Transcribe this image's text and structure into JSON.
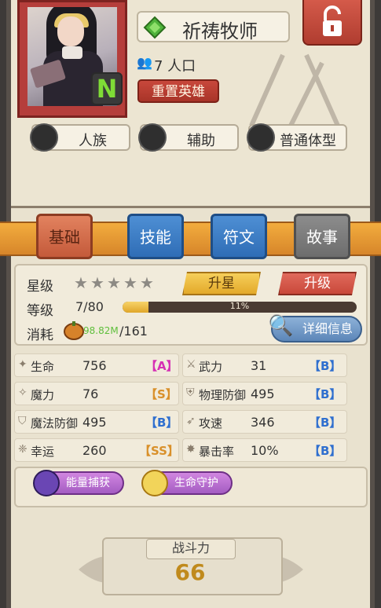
{
  "hero": {
    "name": "祈祷牧师",
    "rarity": "N",
    "population": "7 人口",
    "reset_label": "重置英雄"
  },
  "tags": [
    {
      "label": "人族",
      "icon": "human-head-icon"
    },
    {
      "label": "辅助",
      "icon": "support-cross-icon"
    },
    {
      "label": "普通体型",
      "icon": "body-silhouette-icon"
    }
  ],
  "tabs": [
    {
      "label": "基础",
      "active": true
    },
    {
      "label": "技能"
    },
    {
      "label": "符文"
    },
    {
      "label": "故事"
    }
  ],
  "stats": {
    "star_label": "星级",
    "stars_filled": 0,
    "stars_total": 5,
    "upstar_label": "升星",
    "uplevel_label": "升级",
    "level_label": "等级",
    "level_value": "7/80",
    "xp_percent_text": "11%",
    "xp_fraction": 0.11,
    "cost_label": "消耗",
    "cost_owned": "98.82M",
    "cost_need": "/161",
    "detail_label": "详细信息"
  },
  "attributes": [
    {
      "name": "生命",
      "value": "756",
      "grade": "【A】",
      "grade_color": "#d62fb4"
    },
    {
      "name": "武力",
      "value": "31",
      "grade": "【B】",
      "grade_color": "#2f6fcf"
    },
    {
      "name": "魔力",
      "value": "76",
      "grade": "【S】",
      "grade_color": "#d9902a"
    },
    {
      "name": "物理防御",
      "value": "495",
      "grade": "【B】",
      "grade_color": "#2f6fcf"
    },
    {
      "name": "魔法防御",
      "value": "495",
      "grade": "【B】",
      "grade_color": "#2f6fcf"
    },
    {
      "name": "攻速",
      "value": "346",
      "grade": "【B】",
      "grade_color": "#2f6fcf"
    },
    {
      "name": "幸运",
      "value": "260",
      "grade": "【SS】",
      "grade_color": "#d9902a"
    },
    {
      "name": "暴击率",
      "value": "10%",
      "grade": "【B】",
      "grade_color": "#2f6fcf"
    }
  ],
  "skills": [
    {
      "label": "能量捕获"
    },
    {
      "label": "生命守护"
    }
  ],
  "power": {
    "label": "战斗力",
    "value": "66"
  }
}
